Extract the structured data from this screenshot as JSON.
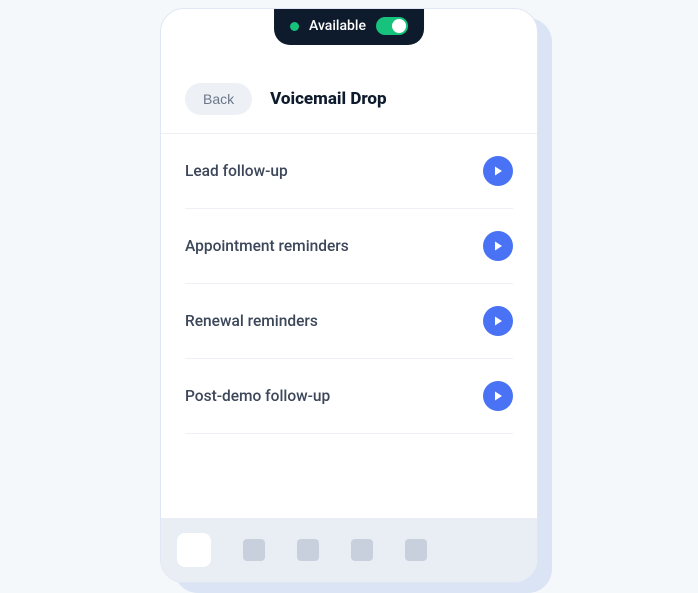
{
  "status": {
    "label": "Available",
    "toggle_on": true
  },
  "header": {
    "back_label": "Back",
    "title": "Voicemail Drop"
  },
  "voicemails": [
    {
      "label": "Lead follow-up"
    },
    {
      "label": "Appointment reminders"
    },
    {
      "label": "Renewal reminders"
    },
    {
      "label": "Post-demo follow-up"
    }
  ]
}
